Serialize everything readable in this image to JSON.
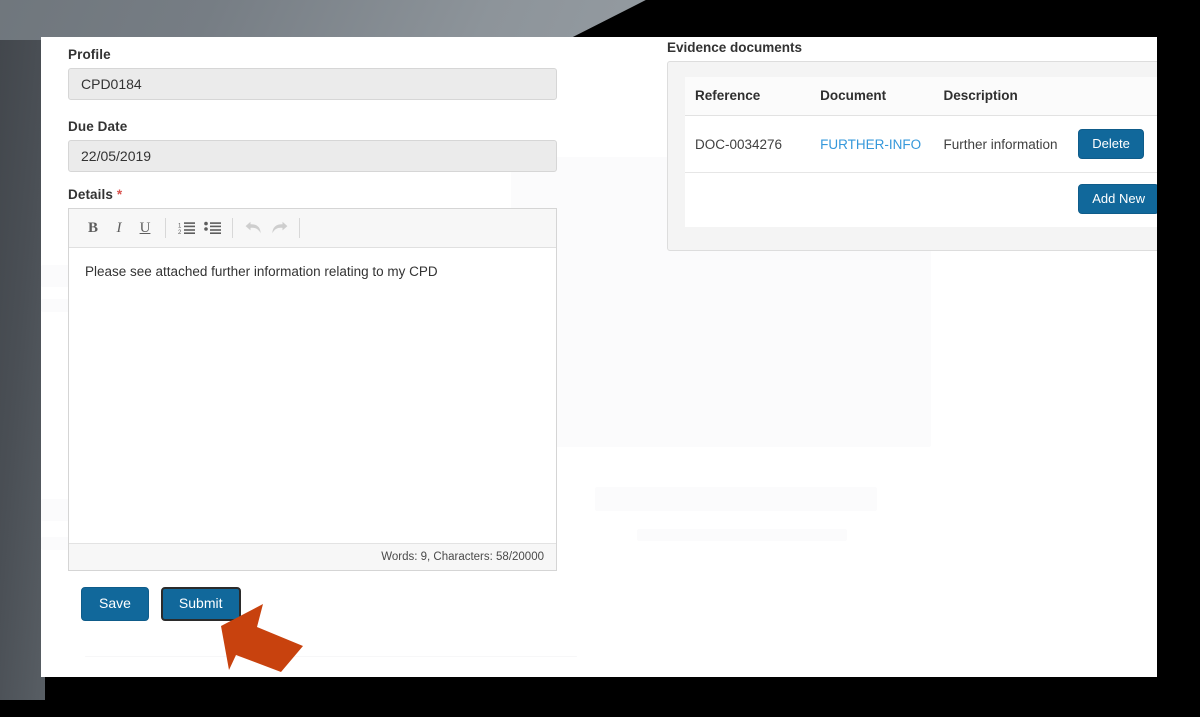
{
  "theme": {
    "accent_blue": "#11689b",
    "link_blue": "#3598db",
    "pointer_orange": "#c8420e",
    "page_bg": "#ffffff",
    "panel_bg": "#f4f4f4",
    "input_bg": "#ebebeb",
    "required_red": "#d9534f",
    "bezel_grey": "#7d848a",
    "bezel_black": "#000000"
  },
  "form": {
    "profile": {
      "label": "Profile",
      "value": "CPD0184",
      "readonly": true
    },
    "due_date": {
      "label": "Due Date",
      "value": "22/05/2019",
      "readonly": true
    },
    "details": {
      "label": "Details",
      "required_marker": "*",
      "content": "Please see attached further information relating to my CPD",
      "status": "Words: 9, Characters: 58/20000",
      "toolbar": [
        {
          "name": "bold-icon",
          "glyph": "B",
          "label": "Bold",
          "disabled": false
        },
        {
          "name": "italic-icon",
          "glyph": "I",
          "label": "Italic",
          "disabled": false
        },
        {
          "name": "underline-icon",
          "glyph": "U",
          "label": "Underline",
          "disabled": false
        },
        {
          "name": "numbered-list-icon",
          "glyph": "",
          "label": "Insert/Remove Numbered List",
          "disabled": false
        },
        {
          "name": "bulleted-list-icon",
          "glyph": "",
          "label": "Insert/Remove Bulleted List",
          "disabled": false
        },
        {
          "name": "undo-icon",
          "glyph": "",
          "label": "Undo",
          "disabled": true
        },
        {
          "name": "redo-icon",
          "glyph": "",
          "label": "Redo",
          "disabled": true
        }
      ]
    }
  },
  "actions": {
    "save_label": "Save",
    "submit_label": "Submit",
    "submit_focused": true
  },
  "evidence": {
    "title": "Evidence documents",
    "columns": [
      "Reference",
      "Document",
      "Description"
    ],
    "rows": [
      {
        "reference": "DOC-0034276",
        "document": "FURTHER-INFO",
        "description": "Further information",
        "delete_label": "Delete"
      }
    ],
    "add_new_label": "Add New"
  },
  "cursor": {
    "name": "arrow-pointer",
    "target": "submit-button",
    "color": "#c8420e"
  }
}
